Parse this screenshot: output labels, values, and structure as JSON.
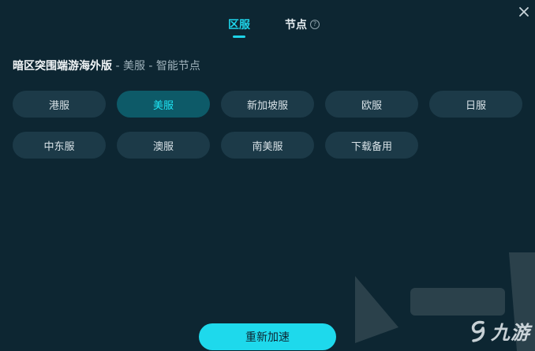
{
  "tabs": [
    {
      "label": "区服",
      "active": true
    },
    {
      "label": "节点",
      "active": false,
      "help_icon": "question-circle-icon"
    }
  ],
  "header": {
    "game_name": "暗区突围端游海外版",
    "separator1": " - ",
    "region": "美服",
    "separator2": " - ",
    "node": "智能节点"
  },
  "regions": [
    {
      "label": "港服",
      "selected": false
    },
    {
      "label": "美服",
      "selected": true
    },
    {
      "label": "新加坡服",
      "selected": false
    },
    {
      "label": "欧服",
      "selected": false
    },
    {
      "label": "日服",
      "selected": false
    },
    {
      "label": "中东服",
      "selected": false
    },
    {
      "label": "澳服",
      "selected": false
    },
    {
      "label": "南美服",
      "selected": false
    },
    {
      "label": "下载备用",
      "selected": false
    }
  ],
  "action": {
    "label": "重新加速"
  },
  "watermark": {
    "text": "九游"
  },
  "colors": {
    "background": "#0d2632",
    "accent": "#1ed3e8",
    "button": "#1c3a48",
    "selected_button": "#0d5a68"
  }
}
